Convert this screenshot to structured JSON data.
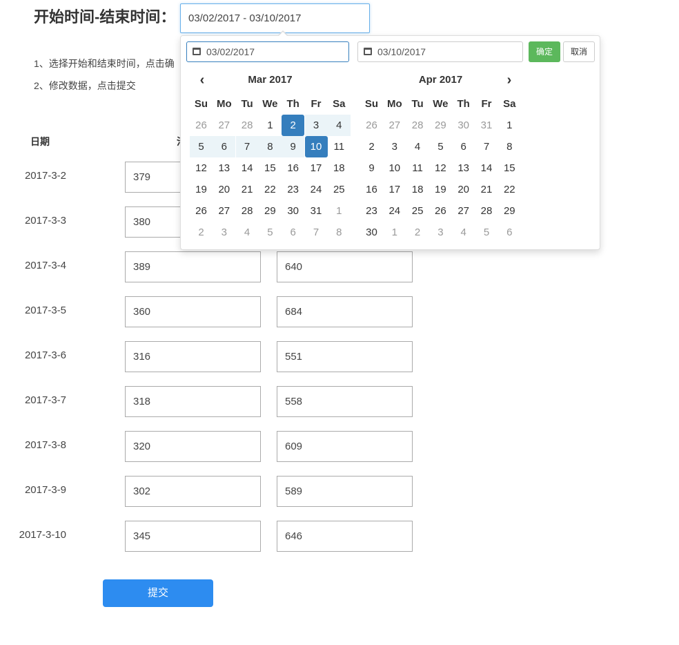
{
  "page": {
    "title": "开始时间-结束时间：",
    "range_value": "03/02/2017 - 03/10/2017",
    "instructions": [
      "1、选择开始和结束时间，点击确",
      "2、修改数据，点击提交"
    ],
    "col_date": "日期",
    "col_hidden_partial": "汁",
    "submit_label": "提交"
  },
  "rows": [
    {
      "date": "2017-3-2",
      "a": "379",
      "b": ""
    },
    {
      "date": "2017-3-3",
      "a": "380",
      "b": ""
    },
    {
      "date": "2017-3-4",
      "a": "389",
      "b": "640"
    },
    {
      "date": "2017-3-5",
      "a": "360",
      "b": "684"
    },
    {
      "date": "2017-3-6",
      "a": "316",
      "b": "551"
    },
    {
      "date": "2017-3-7",
      "a": "318",
      "b": "558"
    },
    {
      "date": "2017-3-8",
      "a": "320",
      "b": "609"
    },
    {
      "date": "2017-3-9",
      "a": "302",
      "b": "589"
    },
    {
      "date": "2017-3-10",
      "a": "345",
      "b": "646"
    }
  ],
  "picker": {
    "start_value": "03/02/2017",
    "end_value": "03/10/2017",
    "ok_label": "确定",
    "cancel_label": "取消",
    "prev_icon": "chevron-left-icon",
    "next_icon": "chevron-right-icon",
    "weekdays": [
      "Su",
      "Mo",
      "Tu",
      "We",
      "Th",
      "Fr",
      "Sa"
    ],
    "left": {
      "month": "Mar 2017",
      "days": [
        [
          "26",
          "27",
          "28",
          "1",
          "2",
          "3",
          "4"
        ],
        [
          "5",
          "6",
          "7",
          "8",
          "9",
          "10",
          "11"
        ],
        [
          "12",
          "13",
          "14",
          "15",
          "16",
          "17",
          "18"
        ],
        [
          "19",
          "20",
          "21",
          "22",
          "23",
          "24",
          "25"
        ],
        [
          "26",
          "27",
          "28",
          "29",
          "30",
          "31",
          "1"
        ],
        [
          "2",
          "3",
          "4",
          "5",
          "6",
          "7",
          "8"
        ]
      ]
    },
    "right": {
      "month": "Apr 2017",
      "days": [
        [
          "26",
          "27",
          "28",
          "29",
          "30",
          "31",
          "1"
        ],
        [
          "2",
          "3",
          "4",
          "5",
          "6",
          "7",
          "8"
        ],
        [
          "9",
          "10",
          "11",
          "12",
          "13",
          "14",
          "15"
        ],
        [
          "16",
          "17",
          "18",
          "19",
          "20",
          "21",
          "22"
        ],
        [
          "23",
          "24",
          "25",
          "26",
          "27",
          "28",
          "29"
        ],
        [
          "30",
          "1",
          "2",
          "3",
          "4",
          "5",
          "6"
        ]
      ]
    },
    "range_start": "2",
    "range_end": "10",
    "colors": {
      "selected": "#357ebd",
      "in_range": "#ebf4f8",
      "ok": "#5cb85c",
      "submit": "#2d8cf0"
    }
  }
}
